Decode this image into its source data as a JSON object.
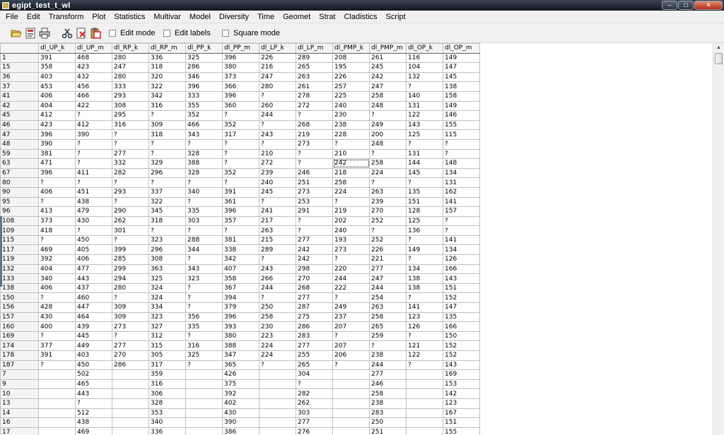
{
  "window": {
    "title": "egipt_test_t_wl",
    "minimize": "–",
    "maximize": "□",
    "close": "✕"
  },
  "menu": [
    "File",
    "Edit",
    "Transform",
    "Plot",
    "Statistics",
    "Multivar",
    "Model",
    "Diversity",
    "Time",
    "Geomet",
    "Strat",
    "Cladistics",
    "Script"
  ],
  "toolbar": {
    "buttons": [
      "open-folder-icon",
      "save-icon",
      "print-icon",
      "cut-icon",
      "delete-icon",
      "paste-icon"
    ],
    "edit_mode": "Edit mode",
    "edit_labels": "Edit labels",
    "square_mode": "Square mode"
  },
  "table": {
    "columns": [
      "dl_UP_k",
      "dl_UP_m",
      "dl_RP_k",
      "dl_RP_m",
      "dl_PP_k",
      "dl_PP_m",
      "dl_LP_k",
      "dl_LP_m",
      "dl_PMP_k",
      "dl_PMP_m",
      "dl_OP_k",
      "dl_OP_m"
    ],
    "selected_cell": {
      "row": 11,
      "col": 8
    },
    "rows": [
      {
        "label": "1",
        "cells": [
          "391",
          "468",
          "280",
          "336",
          "325",
          "396",
          "226",
          "289",
          "208",
          "261",
          "116",
          "149"
        ]
      },
      {
        "label": "15",
        "cells": [
          "358",
          "423",
          "247",
          "318",
          "286",
          "380",
          "216",
          "265",
          "195",
          "245",
          "104",
          "147"
        ]
      },
      {
        "label": "36",
        "cells": [
          "403",
          "432",
          "280",
          "320",
          "346",
          "373",
          "247",
          "263",
          "226",
          "242",
          "132",
          "145"
        ]
      },
      {
        "label": "37",
        "cells": [
          "453",
          "456",
          "333",
          "322",
          "396",
          "366",
          "280",
          "261",
          "257",
          "247",
          "?",
          "138"
        ]
      },
      {
        "label": "41",
        "cells": [
          "406",
          "466",
          "293",
          "342",
          "333",
          "396",
          "?",
          "278",
          "225",
          "258",
          "140",
          "158"
        ]
      },
      {
        "label": "42",
        "cells": [
          "404",
          "422",
          "308",
          "316",
          "355",
          "360",
          "260",
          "272",
          "240",
          "248",
          "131",
          "149"
        ]
      },
      {
        "label": "45",
        "cells": [
          "412",
          "?",
          "295",
          "?",
          "352",
          "?",
          "244",
          "?",
          "230",
          "?",
          "122",
          "146"
        ]
      },
      {
        "label": "46",
        "cells": [
          "423",
          "412",
          "316",
          "309",
          "466",
          "352",
          "?",
          "268",
          "238",
          "249",
          "143",
          "155"
        ]
      },
      {
        "label": "47",
        "cells": [
          "396",
          "390",
          "?",
          "318",
          "343",
          "317",
          "243",
          "219",
          "228",
          "200",
          "125",
          "115"
        ]
      },
      {
        "label": "48",
        "cells": [
          "390",
          "?",
          "?",
          "?",
          "?",
          "?",
          "?",
          "273",
          "?",
          "248",
          "?",
          "?"
        ]
      },
      {
        "label": "59",
        "cells": [
          "381",
          "?",
          "277",
          "?",
          "328",
          "?",
          "210",
          "?",
          "210",
          "?",
          "131",
          "?"
        ]
      },
      {
        "label": "63",
        "cells": [
          "471",
          "?",
          "332",
          "329",
          "388",
          "?",
          "272",
          "?",
          "242",
          "258",
          "144",
          "148"
        ]
      },
      {
        "label": "67",
        "cells": [
          "396",
          "411",
          "282",
          "296",
          "328",
          "352",
          "239",
          "246",
          "218",
          "224",
          "145",
          "134"
        ]
      },
      {
        "label": "80",
        "cells": [
          "?",
          "?",
          "?",
          "?",
          "?",
          "?",
          "240",
          "251",
          "258",
          "?",
          "?",
          "131"
        ]
      },
      {
        "label": "90",
        "cells": [
          "406",
          "451",
          "293",
          "337",
          "340",
          "391",
          "245",
          "273",
          "224",
          "263",
          "135",
          "162"
        ]
      },
      {
        "label": "95",
        "cells": [
          "?",
          "438",
          "?",
          "322",
          "?",
          "361",
          "?",
          "253",
          "?",
          "239",
          "151",
          "141"
        ]
      },
      {
        "label": "96",
        "cells": [
          "413",
          "479",
          "290",
          "345",
          "335",
          "396",
          "241",
          "291",
          "219",
          "270",
          "128",
          "157"
        ]
      },
      {
        "label": "108",
        "cells": [
          "373",
          "430",
          "262",
          "318",
          "303",
          "357",
          "217",
          "?",
          "202",
          "252",
          "125",
          "?"
        ]
      },
      {
        "label": "109",
        "cells": [
          "418",
          "?",
          "301",
          "?",
          "?",
          "?",
          "263",
          "?",
          "240",
          "?",
          "136",
          "?"
        ]
      },
      {
        "label": "115",
        "cells": [
          "?",
          "450",
          "?",
          "323",
          "288",
          "381",
          "215",
          "277",
          "193",
          "252",
          "?",
          "141"
        ]
      },
      {
        "label": "117",
        "cells": [
          "469",
          "405",
          "399",
          "296",
          "344",
          "338",
          "289",
          "242",
          "273",
          "226",
          "149",
          "134"
        ]
      },
      {
        "label": "119",
        "cells": [
          "392",
          "406",
          "285",
          "308",
          "?",
          "342",
          "?",
          "242",
          "?",
          "221",
          "?",
          "126"
        ]
      },
      {
        "label": "132",
        "cells": [
          "404",
          "477",
          "299",
          "363",
          "343",
          "407",
          "243",
          "298",
          "220",
          "277",
          "134",
          "166"
        ]
      },
      {
        "label": "133",
        "cells": [
          "340",
          "443",
          "294",
          "325",
          "323",
          "358",
          "266",
          "270",
          "244",
          "247",
          "138",
          "143"
        ]
      },
      {
        "label": "138",
        "cells": [
          "406",
          "437",
          "280",
          "324",
          "?",
          "367",
          "244",
          "268",
          "222",
          "244",
          "138",
          "151"
        ]
      },
      {
        "label": "150",
        "cells": [
          "?",
          "460",
          "?",
          "324",
          "?",
          "394",
          "?",
          "277",
          "?",
          "254",
          "?",
          "152"
        ]
      },
      {
        "label": "156",
        "cells": [
          "428",
          "447",
          "309",
          "334",
          "?",
          "379",
          "250",
          "287",
          "249",
          "263",
          "141",
          "147"
        ]
      },
      {
        "label": "157",
        "cells": [
          "430",
          "464",
          "309",
          "323",
          "356",
          "396",
          "258",
          "275",
          "237",
          "258",
          "123",
          "135"
        ]
      },
      {
        "label": "160",
        "cells": [
          "400",
          "439",
          "273",
          "327",
          "335",
          "393",
          "230",
          "286",
          "207",
          "265",
          "126",
          "166"
        ]
      },
      {
        "label": "169",
        "cells": [
          "?",
          "445",
          "?",
          "312",
          "?",
          "380",
          "223",
          "283",
          "?",
          "259",
          "?",
          "150"
        ]
      },
      {
        "label": "174",
        "cells": [
          "377",
          "449",
          "277",
          "315",
          "316",
          "388",
          "224",
          "277",
          "207",
          "?",
          "121",
          "152"
        ]
      },
      {
        "label": "178",
        "cells": [
          "391",
          "403",
          "270",
          "305",
          "325",
          "347",
          "224",
          "255",
          "206",
          "238",
          "122",
          "152"
        ]
      },
      {
        "label": "187",
        "cells": [
          "?",
          "450",
          "286",
          "317",
          "?",
          "365",
          "?",
          "265",
          "?",
          "244",
          "?",
          "143"
        ]
      },
      {
        "label": "7",
        "cells": [
          "",
          "502",
          "",
          "359",
          "",
          "426",
          "",
          "304",
          "",
          "277",
          "",
          "169"
        ]
      },
      {
        "label": "9",
        "cells": [
          "",
          "465",
          "",
          "316",
          "",
          "375",
          "",
          "?",
          "",
          "246",
          "",
          "153"
        ]
      },
      {
        "label": "10",
        "cells": [
          "",
          "443",
          "",
          "306",
          "",
          "392",
          "",
          "282",
          "",
          "258",
          "",
          "142"
        ]
      },
      {
        "label": "13",
        "cells": [
          "",
          "?",
          "",
          "328",
          "",
          "402",
          "",
          "262",
          "",
          "238",
          "",
          "123"
        ]
      },
      {
        "label": "14",
        "cells": [
          "",
          "512",
          "",
          "353",
          "",
          "430",
          "",
          "303",
          "",
          "283",
          "",
          "167"
        ]
      },
      {
        "label": "16",
        "cells": [
          "",
          "438",
          "",
          "340",
          "",
          "390",
          "",
          "277",
          "",
          "250",
          "",
          "151"
        ]
      },
      {
        "label": "17",
        "cells": [
          "",
          "469",
          "",
          "336",
          "",
          "386",
          "",
          "276",
          "",
          "251",
          "",
          "155"
        ]
      }
    ]
  }
}
